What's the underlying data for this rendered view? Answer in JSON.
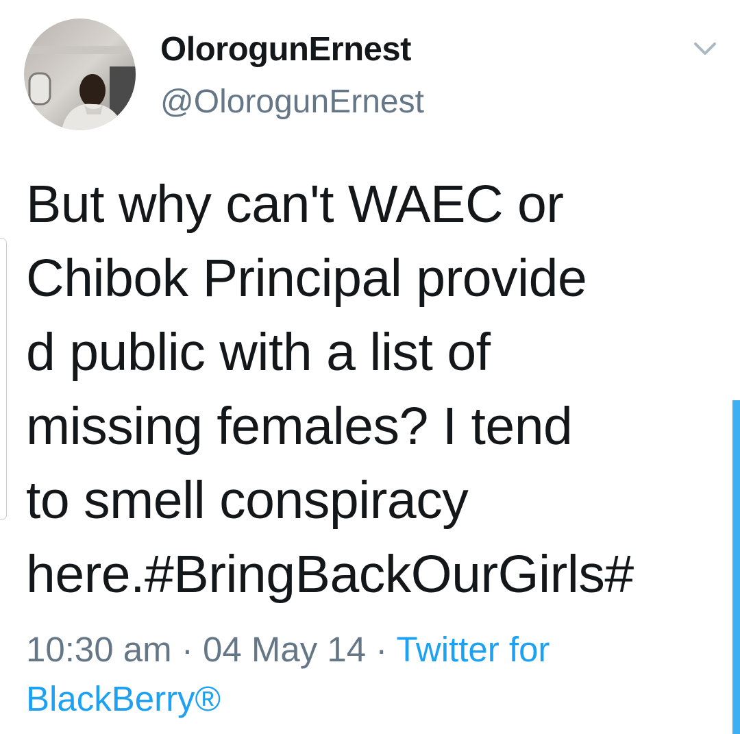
{
  "user": {
    "display_name": "OlorogunErnest",
    "handle": "@OlorogunErnest",
    "avatar_icon": "avatar-photo"
  },
  "header": {
    "menu_icon": "chevron-down-icon"
  },
  "tweet": {
    "lines": [
      "But why can't WAEC or",
      "Chibok Principal provide",
      "d public with a list of",
      "missing females? I tend",
      "to smell conspiracy",
      "here.#BringBackOurGirls#"
    ]
  },
  "meta": {
    "time": "10:30 am",
    "separator": " · ",
    "date": "04 May 14",
    "source_line1": "Twitter for",
    "source_line2": "BlackBerry®"
  },
  "colors": {
    "text": "#14171a",
    "secondary": "#657786",
    "link": "#1da1f2"
  }
}
